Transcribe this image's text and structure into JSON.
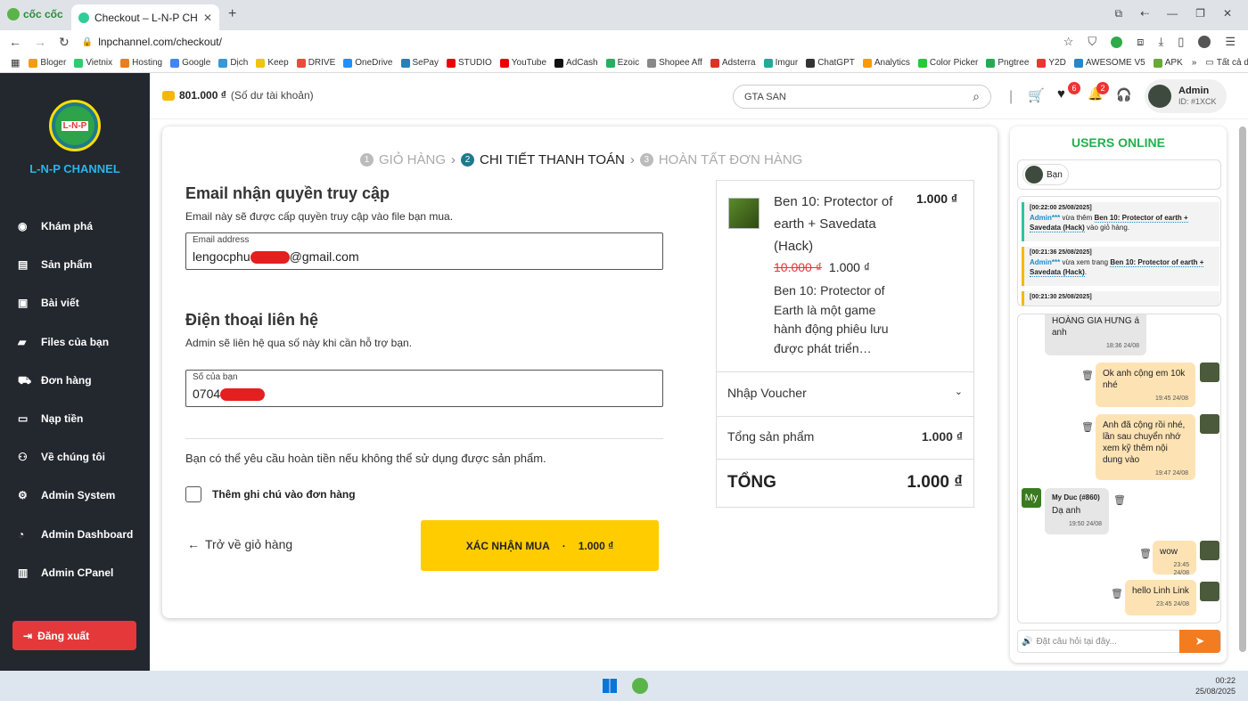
{
  "browser": {
    "app_name": "cốc cốc",
    "tab_title": "Checkout – L-N-P CHANNE",
    "url": "lnpchannel.com/checkout/",
    "bookmarks": [
      "Bloger",
      "Vietnix",
      "Hosting",
      "Google",
      "Dịch",
      "Keep",
      "DRIVE",
      "OneDrive",
      "SePay",
      "STUDIO",
      "YouTube",
      "AdCash",
      "Ezoic",
      "Shopee Aff",
      "Adsterra",
      "Imgur",
      "ChatGPT",
      "Analytics",
      "Color Picker",
      "Pngtree",
      "Y2D",
      "AWESOME V5",
      "APK"
    ],
    "all_bookmarks": "Tất cả dấu trang"
  },
  "sidebar": {
    "brand": "L-N-P CHANNEL",
    "logo_text": "L-N-P",
    "items": [
      "Khám phá",
      "Sản phẩm",
      "Bài viết",
      "Files của bạn",
      "Đơn hàng",
      "Nạp tiền",
      "Về chúng tôi",
      "Admin System",
      "Admin Dashboard",
      "Admin CPanel"
    ],
    "logout": "Đăng xuất"
  },
  "header": {
    "balance": "801.000 ₫",
    "balance_note": "(Số dư tài khoản)",
    "search_value": "GTA SAN",
    "wishlist_count": "6",
    "notif_count": "2",
    "user_name": "Admin",
    "user_id": "ID: #1XCK"
  },
  "steps": [
    {
      "num": "1",
      "label": "GIỎ HÀNG"
    },
    {
      "num": "2",
      "label": "CHI TIẾT THANH TOÁN"
    },
    {
      "num": "3",
      "label": "HOÀN TẤT ĐƠN HÀNG"
    }
  ],
  "form": {
    "email_title": "Email nhận quyền truy cập",
    "email_desc": "Email này sẽ được cấp quyền truy cập vào file bạn mua.",
    "email_label": "Email address",
    "email_value_a": "lengocphu",
    "email_value_b": "@gmail.com",
    "phone_title": "Điện thoại liên hệ",
    "phone_desc": "Admin sẽ liên hệ qua số này khi cần hỗ trợ bạn.",
    "phone_label": "Số của bạn",
    "phone_value": "0704",
    "refund_note": "Bạn có thể yêu cầu hoàn tiền nếu không thể sử dụng được sản phẩm.",
    "note_checkbox": "Thêm ghi chú vào đơn hàng",
    "back_link": "Trở về giỏ hàng",
    "confirm_button": "XÁC NHẬN MUA",
    "confirm_sep": "·",
    "confirm_price": "1.000 ₫"
  },
  "order": {
    "product_lines": [
      "Ben 10: Protector of",
      "earth + Savedata",
      "(Hack)"
    ],
    "product_price": "1.000 ₫",
    "old_price": "10.000 ₫",
    "new_price": "1.000 ₫",
    "desc_lines": [
      "Ben 10: Protector of",
      "Earth là một game",
      "hành động phiêu lưu",
      "được phát triển…"
    ],
    "voucher": "Nhập Voucher",
    "subtotal_label": "Tổng sản phẩm",
    "subtotal_value": "1.000 ₫",
    "total_label": "TỔNG",
    "total_value": "1.000 ₫"
  },
  "chat": {
    "title": "USERS ONLINE",
    "me": "Bạn",
    "activity": [
      {
        "time": "[00:22:00 25/08/2025]",
        "user": "Admin***",
        "action": "vừa thêm",
        "product": "Ben 10: Protector of earth + Savedata (Hack)",
        "suffix": "vào giỏ hàng."
      },
      {
        "time": "[00:21:36 25/08/2025]",
        "user": "Admin***",
        "action": "vừa xem trang",
        "product": "Ben 10: Protector of earth + Savedata (Hack)",
        "suffix": "."
      },
      {
        "time": "[00:21:30 25/08/2025]"
      }
    ],
    "messages": [
      {
        "text": "tên NGUYỄN HOÀNG GIA HƯNG á anh",
        "time": "18:36 24/08"
      },
      {
        "text": "Ok anh cộng em 10k nhé",
        "time": "19:45 24/08"
      },
      {
        "text": "Anh đã cộng rồi nhé, lần sau chuyển nhớ xem kỹ thêm nội dung vào",
        "time": "19:47 24/08"
      },
      {
        "name": "My Duc (#860)",
        "avatar": "My",
        "text": "Dạ anh",
        "time": "19:50 24/08"
      },
      {
        "text": "wow",
        "time": "23:45 24/08"
      },
      {
        "text": "hello Linh Link",
        "time": "23:45 24/08"
      }
    ],
    "input_placeholder": "Đặt câu hỏi tại đây..."
  },
  "taskbar": {
    "time": "00:22",
    "date": "25/08/2025"
  },
  "colors": {
    "accent_teal": "#1e7a8c",
    "confirm_yellow": "#ffcc00",
    "logout_red": "#e5383b",
    "online_green": "#22b14c"
  }
}
